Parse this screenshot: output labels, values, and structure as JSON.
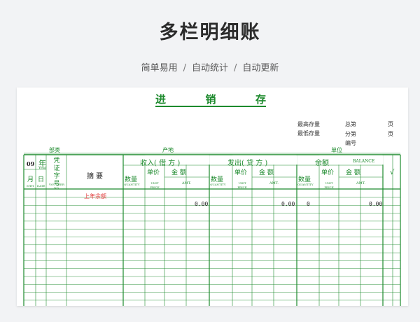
{
  "page": {
    "title": "多栏明细账",
    "subtitle": [
      "简单易用",
      "自动统计",
      "自动更新"
    ],
    "separator": "/"
  },
  "sheet": {
    "title": "进 销 存",
    "info": {
      "max_stock": "最高存量",
      "min_stock": "最低存量",
      "total_page": "总第",
      "sub_page": "分第",
      "number": "编号",
      "page_unit": "页"
    },
    "meta": {
      "dept": "部类",
      "origin": "产地",
      "unit": "单位"
    },
    "headers": {
      "year_value": "09",
      "year": "年",
      "year_en": "Year",
      "month": "月",
      "month_en": "MTH",
      "day": "日",
      "day_en": "DATE",
      "voucher": "凭证字号",
      "voucher_en": "VOUCHER NO.",
      "summary": "摘 要",
      "income": "收入( 借 方 )",
      "outgo": "发出( 贷 方 )",
      "balance": "余额",
      "balance_en": "BALANCE",
      "qty": "数量",
      "qty_en": "QUANTITY",
      "price": "单价",
      "price_en": "UNIT PRICE",
      "amount": "金 额",
      "amount_en": "AMT.",
      "check": "√"
    },
    "first_row": {
      "summary": "上年余额",
      "income_amt": "0.00",
      "outgo_amt": "0.00",
      "balance_qty": "0",
      "balance_amt": "0.00"
    },
    "colors": {
      "line": "#1d8a2d",
      "highlight": "#e23b3b"
    }
  }
}
